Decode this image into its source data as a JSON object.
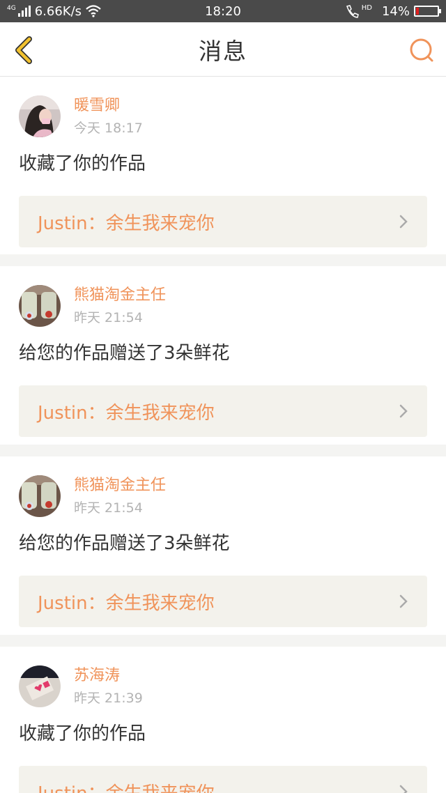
{
  "status_bar": {
    "network": "4G",
    "speed": "6.66K/s",
    "time": "18:20",
    "hd": "HD",
    "battery": "14%",
    "battery_level": 0.14
  },
  "header": {
    "title": "消息"
  },
  "colors": {
    "accent": "#f0935a",
    "back": "#f2c230"
  },
  "messages": [
    {
      "username": "暖雪卿",
      "time": "今天 18:17",
      "action": "收藏了你的作品",
      "work": "Justin：余生我来宠你",
      "avatar": "girl-avatar"
    },
    {
      "username": "熊猫淘金主任",
      "time": "昨天 21:54",
      "action": "给您的作品赠送了3朵鲜花",
      "work": "Justin：余生我来宠你",
      "avatar": "jars-avatar"
    },
    {
      "username": "熊猫淘金主任",
      "time": "昨天 21:54",
      "action": "给您的作品赠送了3朵鲜花",
      "work": "Justin：余生我来宠你",
      "avatar": "jars-avatar"
    },
    {
      "username": "苏海涛",
      "time": "昨天 21:39",
      "action": "收藏了你的作品",
      "work": "Justin：余生我来宠你",
      "avatar": "love-avatar"
    }
  ]
}
